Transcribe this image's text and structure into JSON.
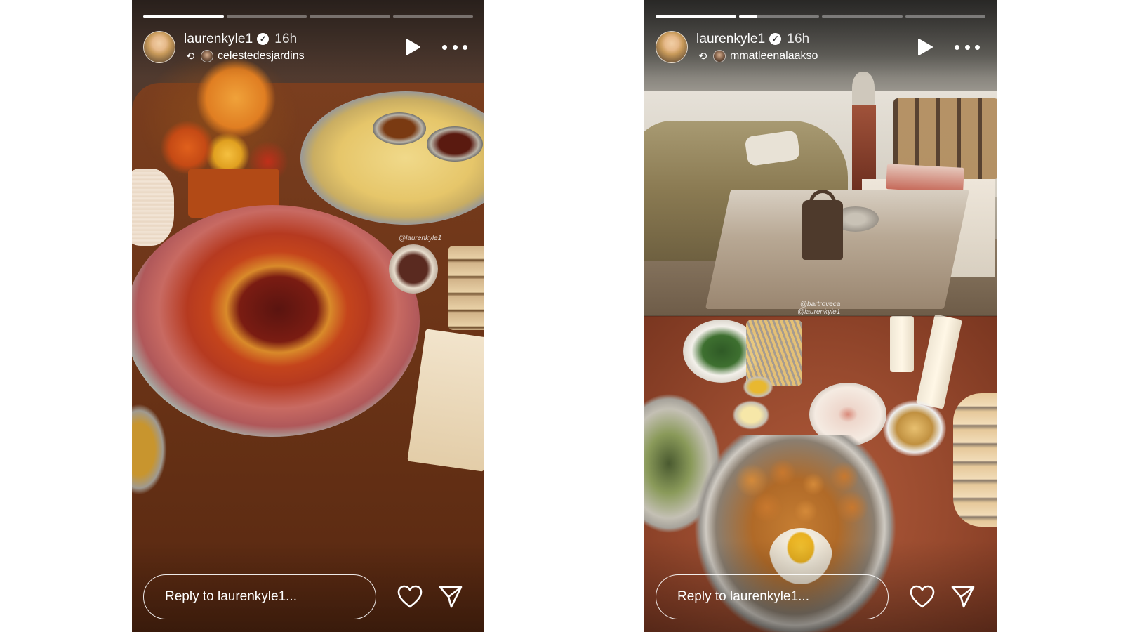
{
  "stories": [
    {
      "username": "laurenkyle1",
      "verified_icon": "verified-badge-icon",
      "time": "16h",
      "repost_from": "celestedesjardins",
      "progress": {
        "segments": 4,
        "active_index": 0,
        "active_fill": 1.0
      },
      "watermarks": [
        "@laurenkyle1"
      ],
      "reply_placeholder": "Reply to laurenkyle1...",
      "icons": {
        "play": "play-icon",
        "more": "more-icon",
        "like": "heart-icon",
        "share": "send-icon"
      }
    },
    {
      "username": "laurenkyle1",
      "verified_icon": "verified-badge-icon",
      "time": "16h",
      "repost_from": "mmatleenalaakso",
      "progress": {
        "segments": 4,
        "active_index": 1,
        "active_fill": 0.22
      },
      "watermarks": [
        "@bartroveca",
        "@laurenkyle1"
      ],
      "reply_placeholder": "Reply to laurenkyle1...",
      "icons": {
        "play": "play-icon",
        "more": "more-icon",
        "like": "heart-icon",
        "share": "send-icon"
      }
    }
  ],
  "colors": {
    "overlay_text": "#ffffff",
    "page_background": "#ffffff"
  }
}
